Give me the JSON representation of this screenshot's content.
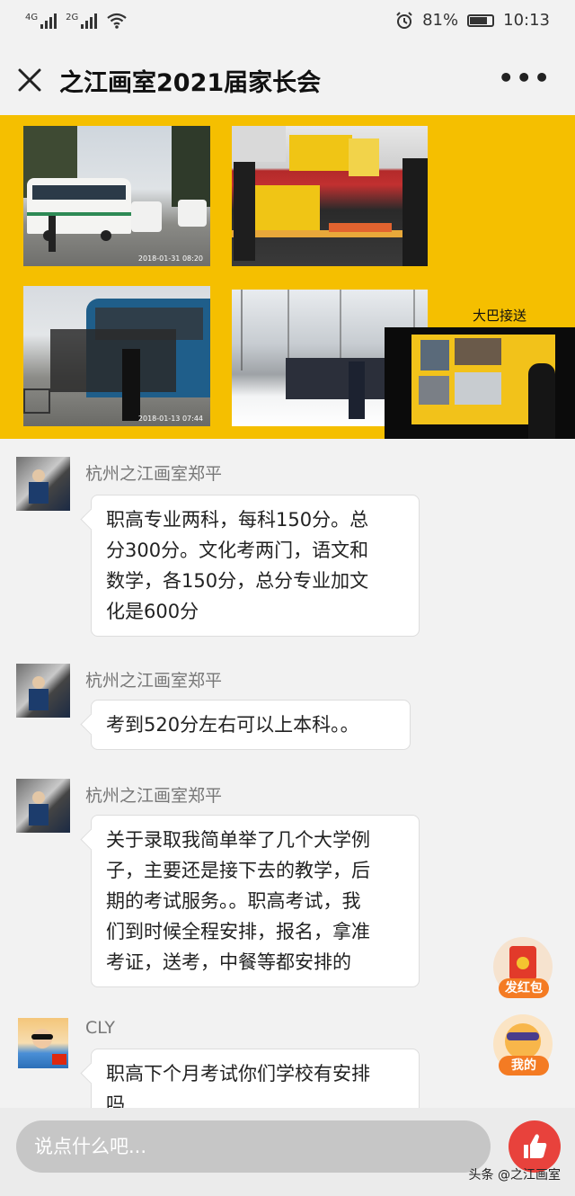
{
  "status_bar": {
    "signal1_label": "4G",
    "signal2_label": "2G",
    "battery_percent": "81%",
    "battery_level": 0.81,
    "time": "10:13"
  },
  "header": {
    "title": "之江画室2021届家长会"
  },
  "banner": {
    "photo1_stamp": "2018-01-31 08:20",
    "photo3_stamp": "2018-01-13 07:44",
    "caption": "大巴接送"
  },
  "messages": [
    {
      "sender": "杭州之江画室郑平",
      "lines": [
        "职高专业两科，每科150分。总",
        "分300分。文化考两门，语文和",
        "数学，各150分，总分专业加文",
        "化是600分"
      ]
    },
    {
      "sender": "杭州之江画室郑平",
      "lines": [
        "考到520分左右可以上本科。。"
      ]
    },
    {
      "sender": "杭州之江画室郑平",
      "lines": [
        "关于录取我简单举了几个大学例",
        "子，主要还是接下去的教学，后",
        "期的考试服务。。职高考试，我",
        "们到时候全程安排，报名，拿准",
        "考证，送考，中餐等都安排的"
      ]
    },
    {
      "sender": "CLY",
      "lines": [
        "职高下个月考试你们学校有安排",
        "吗"
      ]
    }
  ],
  "floating": {
    "red_packet_label": "发红包",
    "mine_label": "我的"
  },
  "bottom_bar": {
    "input_placeholder": "说点什么吧...",
    "watermark": "头条 @之江画室"
  },
  "colors": {
    "banner_bg": "#f5bf00",
    "like_button": "#e8423c",
    "float_label": "#f47b23"
  }
}
